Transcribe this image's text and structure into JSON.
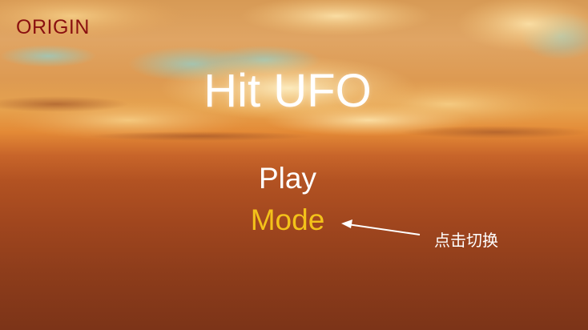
{
  "game": {
    "mode_label": "ORIGIN",
    "title": "Hit UFO",
    "menu": {
      "play_label": "Play",
      "mode_label": "Mode"
    },
    "hint": "点击切换",
    "colors": {
      "mode_label": "#8a1010",
      "title": "#ffffff",
      "play": "#ffffff",
      "mode": "#f3c21a",
      "hint": "#ffffff",
      "arrow": "#ffffff"
    },
    "icons": {
      "arrow": "arrow-left-icon"
    }
  }
}
